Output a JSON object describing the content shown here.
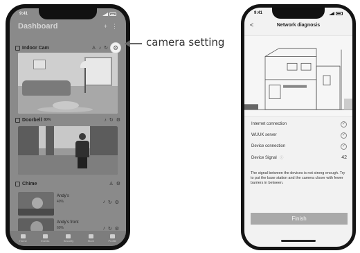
{
  "left_phone": {
    "status_time": "9:41",
    "header": {
      "title": "Dashboard",
      "add_label": "+",
      "menu_label": "⋮"
    },
    "cameras": [
      {
        "name": "Indoor Cam"
      },
      {
        "name": "Doorbell",
        "meta": "80%"
      },
      {
        "name": "Chime"
      }
    ],
    "sub_devices": [
      {
        "name": "Andy's",
        "meta": "40%"
      },
      {
        "name": "Andy's front",
        "meta": "60%"
      }
    ],
    "tabs": [
      "Home",
      "Events",
      "Security",
      "Store",
      "Profile"
    ]
  },
  "callout": {
    "label": "camera setting"
  },
  "right_phone": {
    "status_time": "9:41",
    "back_label": "<",
    "title": "Network diagnosis",
    "rows": [
      {
        "label": "Internet connection",
        "status": "ok"
      },
      {
        "label": "WUUK server",
        "status": "ok"
      },
      {
        "label": "Device connection",
        "status": "ok"
      },
      {
        "label": "Device Signal",
        "value": "42"
      }
    ],
    "message": "The signal between the devices is not strong enough. Try to put the base station and the camera closer with fewer barriers in between.",
    "finish_label": "Finish"
  },
  "icons": {
    "settings": "gear-icon",
    "history": "replay-icon",
    "bell": "bell-icon",
    "person": "person-icon",
    "check": "check-circle-icon",
    "info": "info-icon"
  },
  "colors": {
    "finish_button": "#a9a9a9",
    "screen_overlay": "#8a8a8a"
  }
}
